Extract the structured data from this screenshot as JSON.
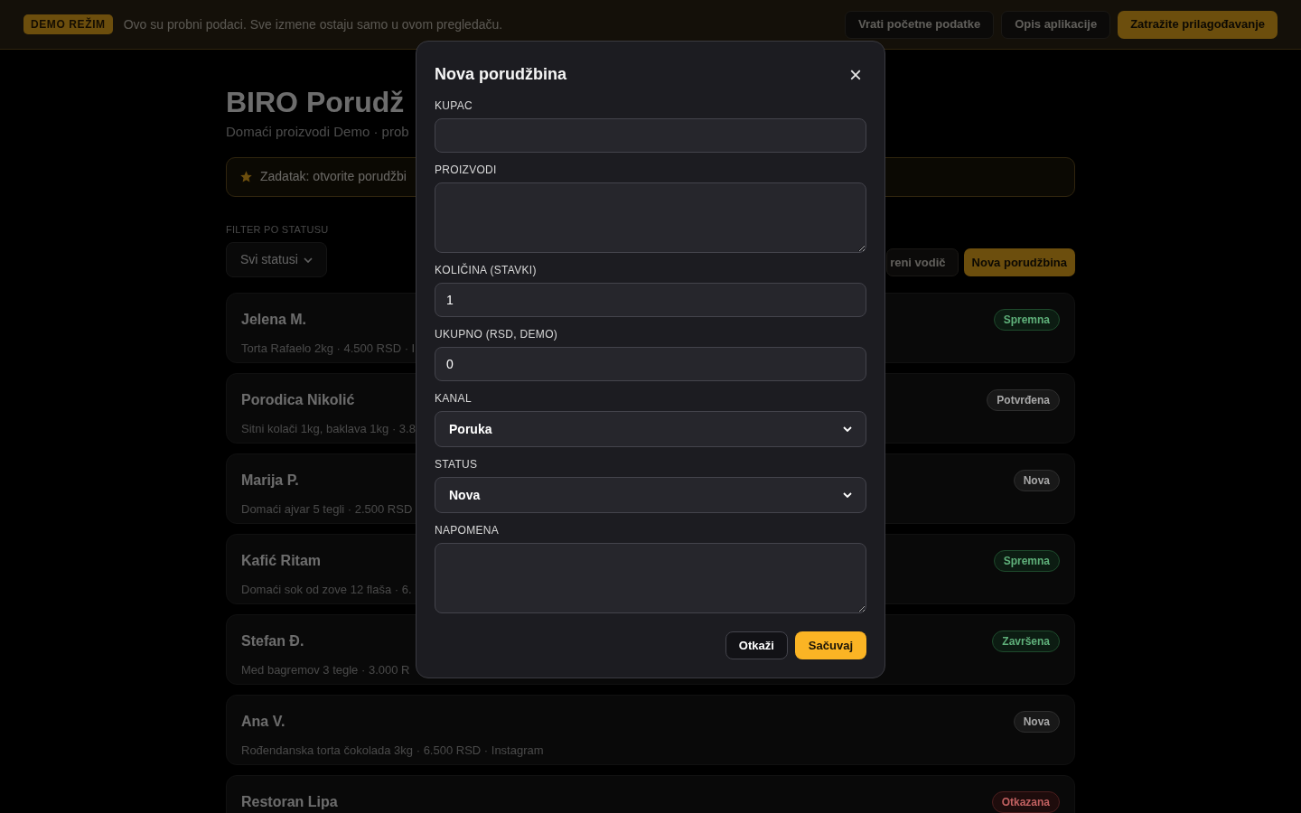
{
  "demo_bar": {
    "badge": "DEMO REŽIM",
    "message": "Ovo su probni podaci. Sve izmene ostaju samo u ovom pregledaču.",
    "buttons": [
      {
        "label": "Vrati početne podatke",
        "kind": "secondary"
      },
      {
        "label": "Opis aplikacije",
        "kind": "secondary"
      },
      {
        "label": "Zatražite prilagođavanje",
        "kind": "primary"
      }
    ]
  },
  "page": {
    "title": "BIRO Porudž",
    "subtitle": "Domaći proizvodi Demo · prob",
    "task": "Zadatak: otvorite porudžbi",
    "filter": {
      "label": "FILTER PO STATUSU",
      "value": "Svi statusi"
    },
    "actions": [
      {
        "label": "reni vodič",
        "kind": "secondary"
      },
      {
        "label": "Nova porudžbina",
        "kind": "primary"
      }
    ]
  },
  "orders": [
    {
      "name": "Jelena M.",
      "details": "Torta Rafaelo 2kg · 4.500 RSD · I",
      "status": "Spremna",
      "kind": "success"
    },
    {
      "name": "Porodica Nikolić",
      "details": "Sitni kolači 1kg, baklava 1kg · 3.8",
      "status": "Potvrđena",
      "kind": "neutral"
    },
    {
      "name": "Marija P.",
      "details": "Domaći ajvar 5 tegli · 2.500 RSD",
      "status": "Nova",
      "kind": "neutral"
    },
    {
      "name": "Kafić Ritam",
      "details": "Domaći sok od zove 12 flaša · 6.",
      "status": "Spremna",
      "kind": "success"
    },
    {
      "name": "Stefan Đ.",
      "details": "Med bagremov 3 tegle · 3.000 R",
      "status": "Završena",
      "kind": "success"
    },
    {
      "name": "Ana V.",
      "details": "Rođendanska torta čokolada 3kg · 6.500 RSD · Instagram",
      "status": "Nova",
      "kind": "neutral"
    },
    {
      "name": "Restoran Lipa",
      "status": "Otkazana",
      "kind": "danger"
    }
  ],
  "dialog": {
    "title": "Nova porudžbina",
    "close": "×",
    "fields": [
      {
        "label": "KUPAC",
        "kind": "input"
      },
      {
        "label": "PROIZVODI",
        "kind": "textarea"
      },
      {
        "label": "KOLIČINA (STAVKI)",
        "kind": "input",
        "value": "1"
      },
      {
        "label": "UKUPNO (RSD, DEMO)",
        "kind": "input",
        "value": "0"
      },
      {
        "label": "KANAL",
        "kind": "select",
        "value": "Poruka"
      },
      {
        "label": "STATUS",
        "kind": "select",
        "value": "Nova"
      },
      {
        "label": "NAPOMENA",
        "kind": "textarea"
      }
    ],
    "buttons": [
      {
        "label": "Otkaži",
        "kind": "secondary"
      },
      {
        "label": "Sačuvaj",
        "kind": "primary"
      }
    ]
  }
}
